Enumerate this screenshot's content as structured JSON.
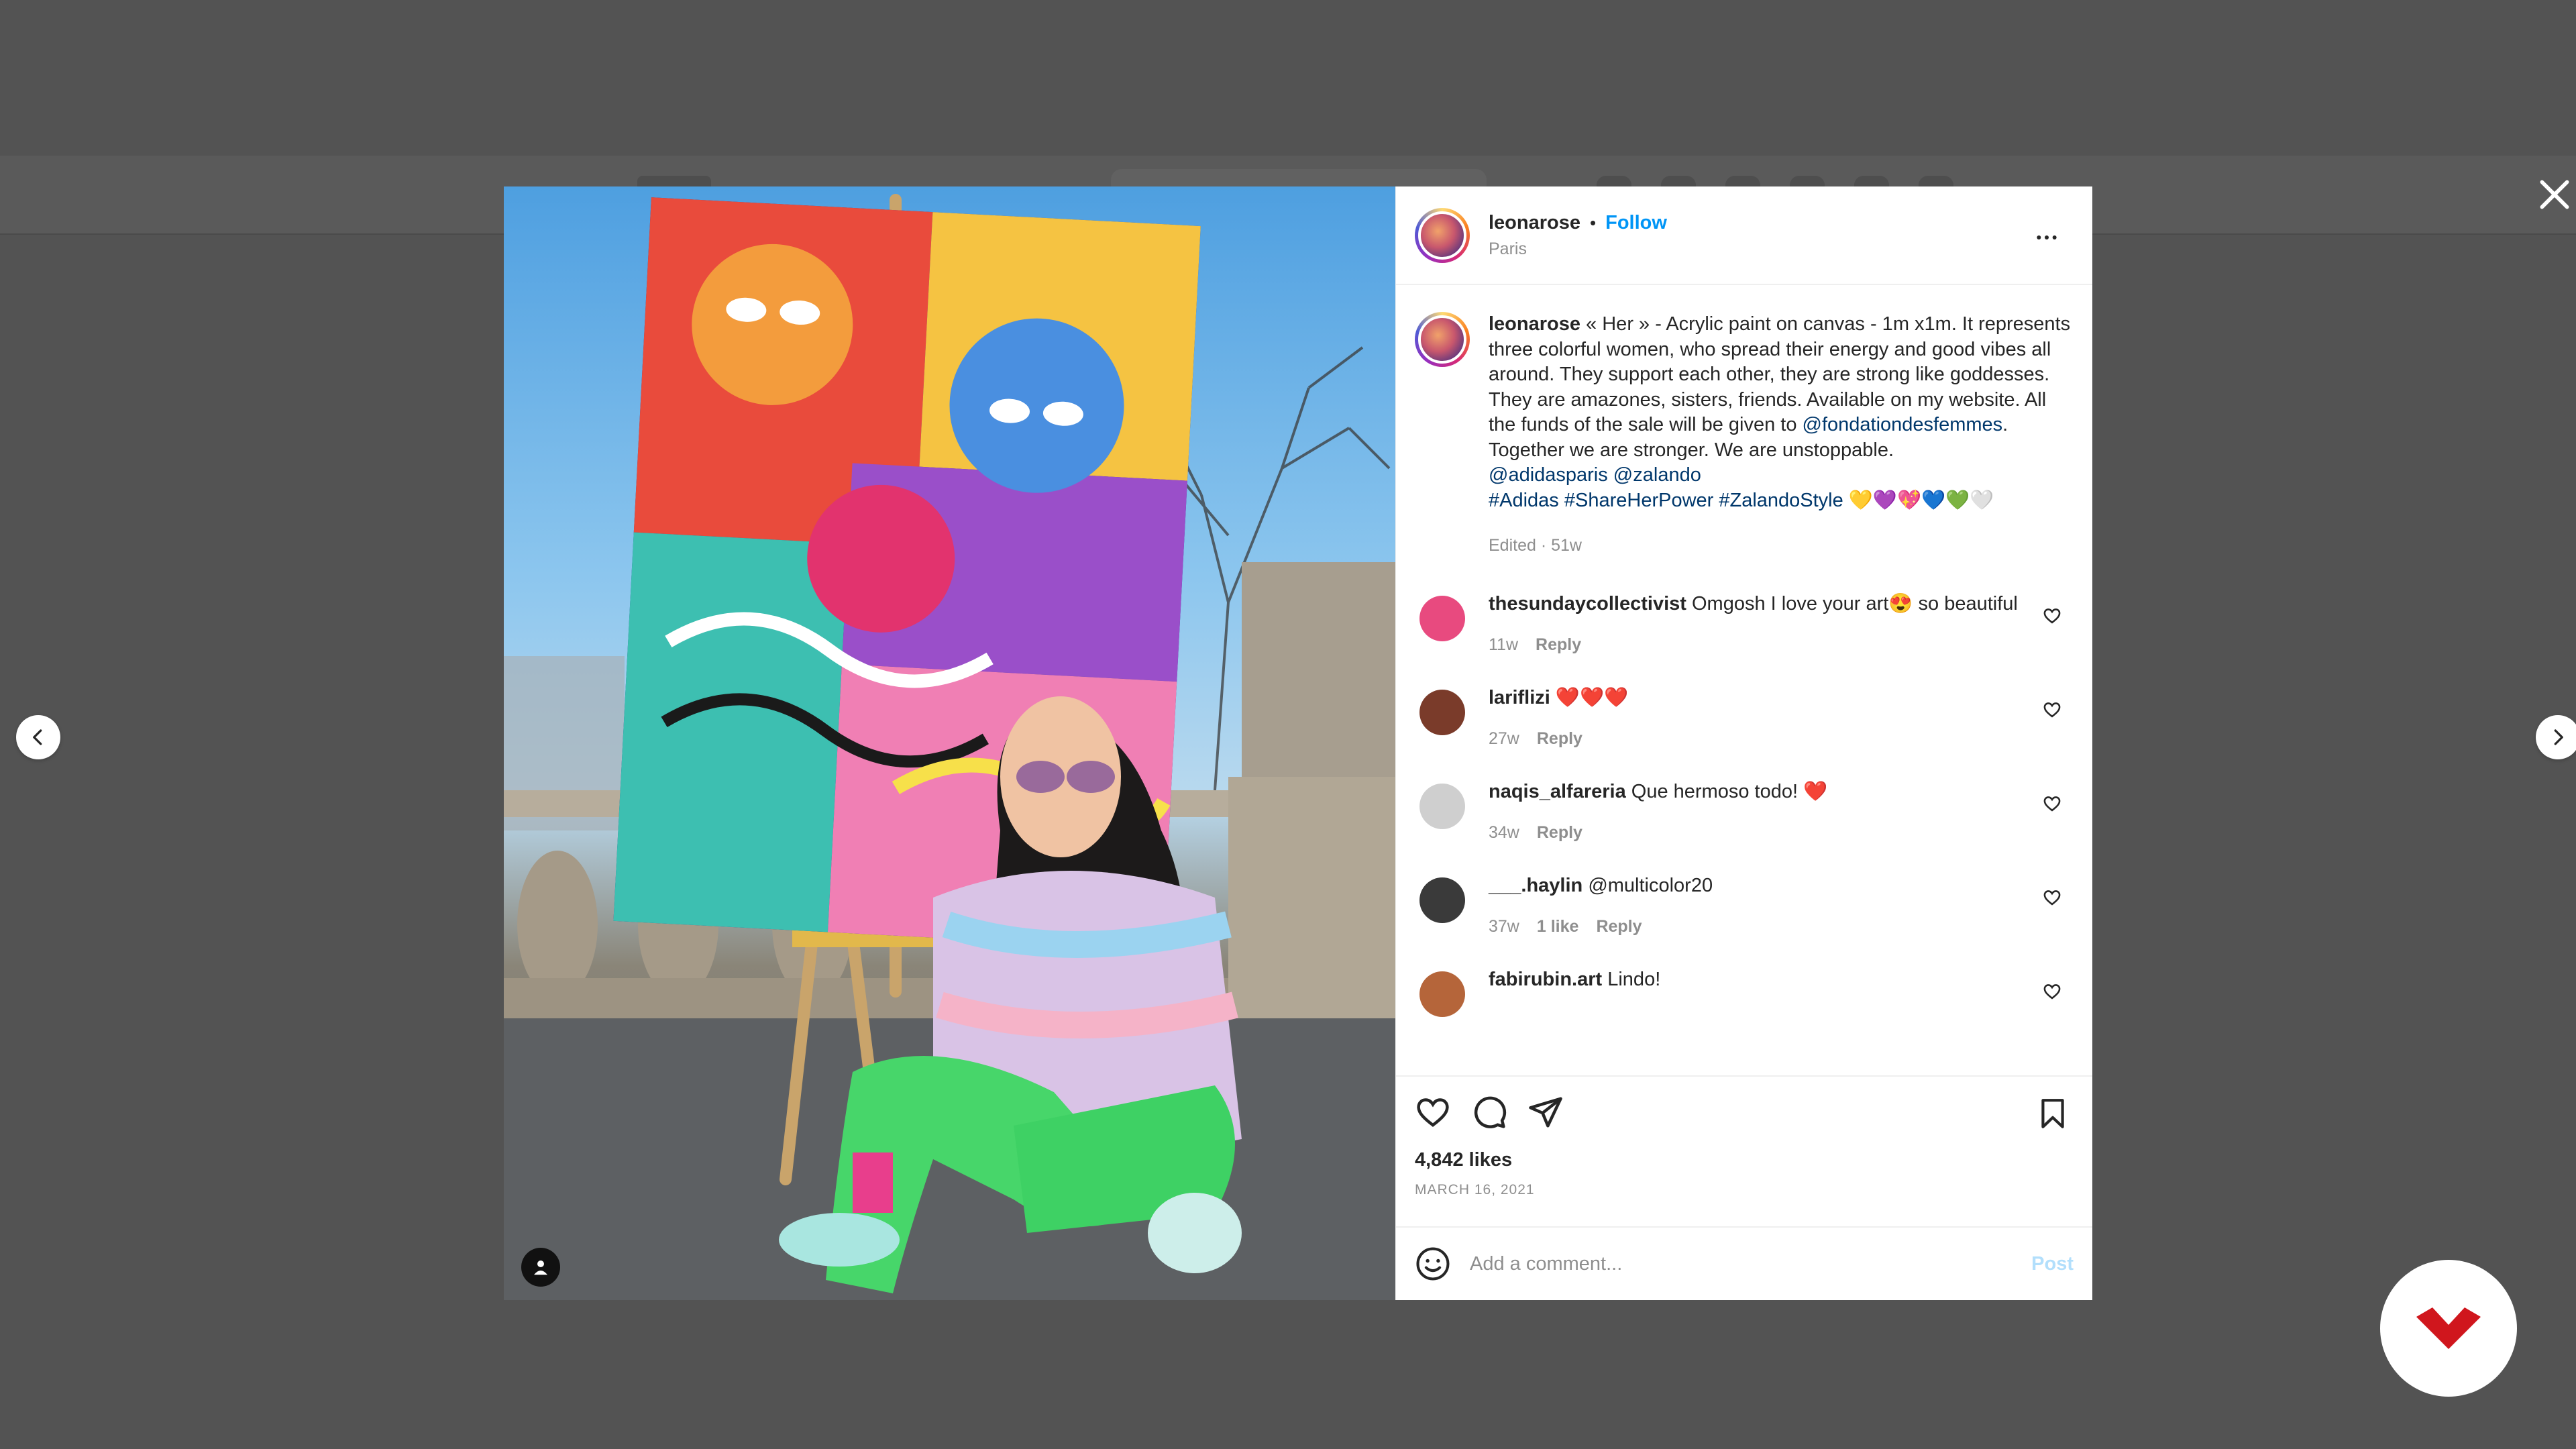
{
  "post": {
    "username": "leonarose",
    "separator": "•",
    "follow_label": "Follow",
    "location": "Paris"
  },
  "caption": {
    "username": "leonarose",
    "text": " « Her » - Acrylic paint on canvas - 1m x1m. It represents three colorful women, who spread their energy and good vibes all around. They support each other, they are strong like goddesses. They are amazones, sisters, friends. Available on my website. All the funds of the sale will be given to ",
    "mention_1": "@fondationdesfemmes",
    "text_2": ". Together we are stronger. We are unstoppable.",
    "mentions_line": "@adidasparis @zalando",
    "hashtags_line": "#Adidas #ShareHerPower #ZalandoStyle",
    "emoji_tail": "💛💜💖💙💚🤍",
    "meta": "Edited · 51w"
  },
  "comments": [
    {
      "username": "thesundaycollectivist",
      "text": "Omgosh I love your art😍 so beautiful",
      "time": "11w",
      "likes": "",
      "reply": "Reply",
      "avatar_color": "#e84a7f"
    },
    {
      "username": "lariflizi",
      "text": "❤️❤️❤️",
      "time": "27w",
      "likes": "",
      "reply": "Reply",
      "avatar_color": "#7a3b2a"
    },
    {
      "username": "naqis_alfareria",
      "text": "Que hermoso todo! ❤️",
      "time": "34w",
      "likes": "",
      "reply": "Reply",
      "avatar_color": "#cfcfcf"
    },
    {
      "username": "___.haylin",
      "text": "@multicolor20",
      "time": "37w",
      "likes": "1 like",
      "reply": "Reply",
      "avatar_color": "#3a3a3a"
    },
    {
      "username": "fabirubin.art",
      "text": "Lindo!",
      "time": "",
      "likes": "",
      "reply": "",
      "avatar_color": "#b5653a"
    }
  ],
  "actions": {
    "likes": "4,842 likes",
    "date": "MARCH 16, 2021"
  },
  "add_comment": {
    "placeholder": "Add a comment...",
    "post_label": "Post"
  },
  "colors": {
    "follow": "#0095f6",
    "link": "#00376b",
    "muted": "#8e8e8e",
    "post_disabled": "#b2dffc",
    "overlay": "#535353"
  },
  "icons": {
    "close": "close-icon",
    "prev": "chevron-left-icon",
    "next": "chevron-right-icon",
    "more": "more-icon",
    "like": "heart-icon",
    "comment": "comment-icon",
    "share": "share-icon",
    "save": "bookmark-icon",
    "emoji": "emoji-icon",
    "tag": "tagged-user-icon",
    "brand": "brand-logo-icon"
  }
}
